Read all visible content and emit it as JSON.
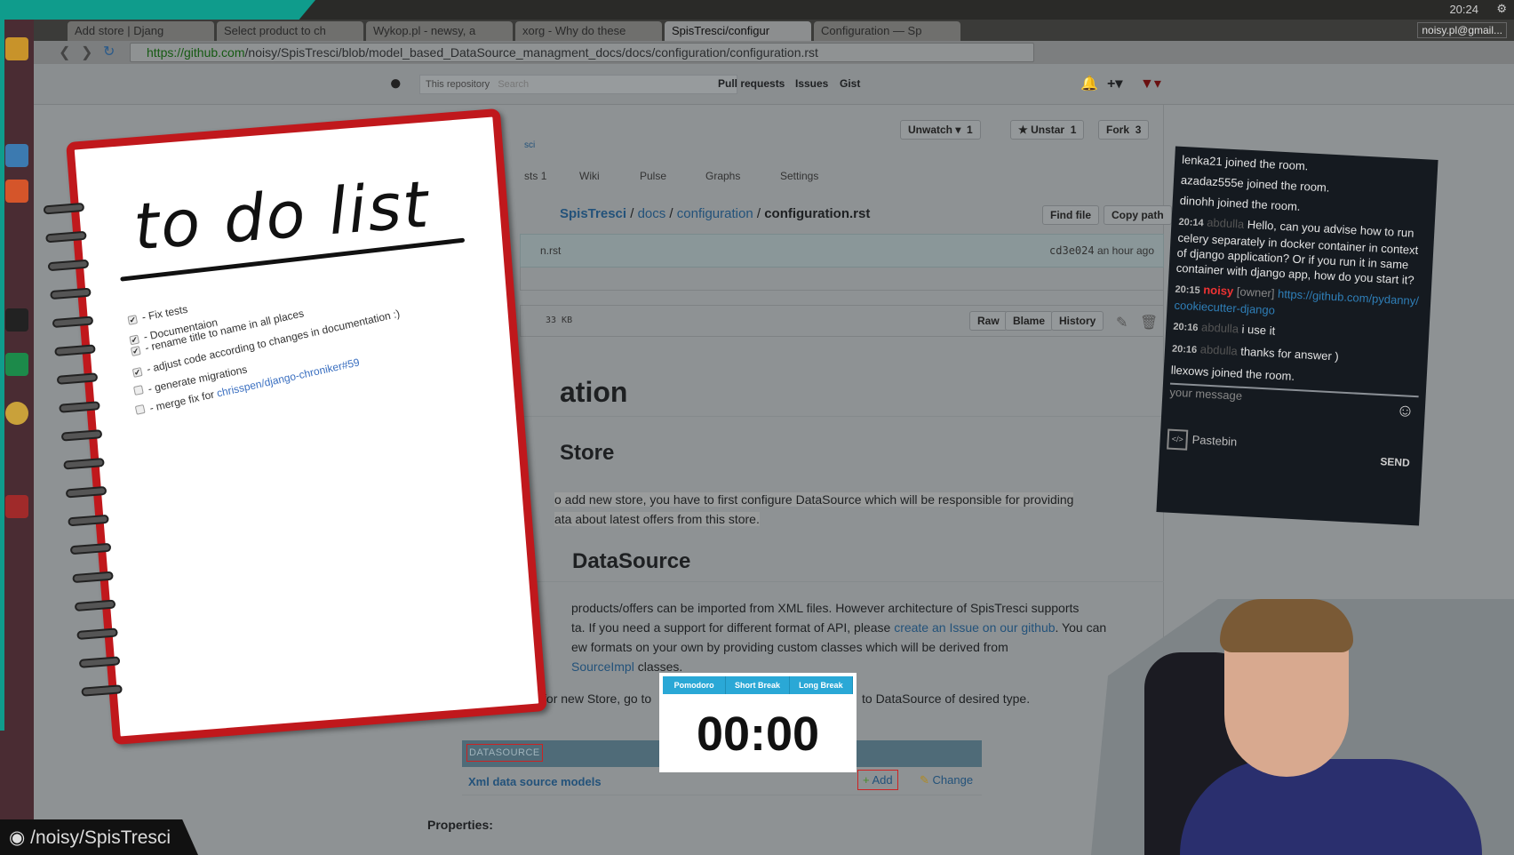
{
  "system": {
    "clock": "20:24",
    "user": "noisy.pl@gmail..."
  },
  "browser": {
    "tabs": [
      {
        "label": "Add store | Djang"
      },
      {
        "label": "Select product to ch"
      },
      {
        "label": "Wykop.pl - newsy, a"
      },
      {
        "label": "xorg - Why do these"
      },
      {
        "label": "SpisTresci/configur"
      },
      {
        "label": "Configuration — Sp"
      }
    ],
    "url_host": "https://github.com",
    "url_path": "/noisy/SpisTresci/blob/model_based_DataSource_managment_docs/docs/configuration/configuration.rst"
  },
  "github": {
    "search_scope": "This repository",
    "search_placeholder": "Search",
    "nav": [
      "Pull requests",
      "Issues",
      "Gist"
    ],
    "repo_fragment": "sci",
    "actions": [
      {
        "label": "Unwatch ▾",
        "count": "1"
      },
      {
        "label": "★ Unstar",
        "count": "1"
      },
      {
        "label": "Fork",
        "count": "3"
      }
    ],
    "tabs": [
      {
        "label": "sts",
        "count": "1"
      },
      {
        "label": "Wiki"
      },
      {
        "label": "Pulse"
      },
      {
        "label": "Graphs"
      },
      {
        "label": "Settings"
      }
    ],
    "breadcrumb": {
      "repo": "SpisTresci",
      "p1": "docs",
      "p2": "configuration",
      "file": "configuration.rst",
      "sep": " / "
    },
    "file_buttons": [
      "Find file",
      "Copy path"
    ],
    "commit": {
      "msg": "n.rst",
      "sha": "cd3e024",
      "time": "an hour ago"
    },
    "file_size": "33 KB",
    "file_actions": [
      "Raw",
      "Blame",
      "History"
    ],
    "content": {
      "h1": "ation",
      "h2a": "Store",
      "p1a": "o add new store, you have to first configure DataSource which will be responsible for providing",
      "p1b": "ata about latest offers from this store.",
      "h2b": "DataSource",
      "p2a": "products/offers can be imported from XML files. However architecture of SpisTresci supports",
      "p2b": "ta. If you need a support for different format of API, please ",
      "p2b_link": "create an Issue on our github",
      "p2b_end": ". You can",
      "p2c": "ew formats on your own by providing custom classes which will be derived from",
      "p2d_link": "SourceImpl",
      "p2d_end": " classes.",
      "p3a": "aSource for new Store, go to",
      "p3b": "to DataSource of desired type.",
      "table_header": "DATASOURCE",
      "table_row": "Xml data source models",
      "add": "Add",
      "change": "Change",
      "properties": "Properties:"
    }
  },
  "todo": {
    "title": "to do list",
    "items": [
      {
        "text": "- Fix tests",
        "checked": true
      },
      {
        "text": "- Documentaion",
        "checked": true
      },
      {
        "text": "- rename title to name in all places",
        "checked": true
      },
      {
        "text": "- adjust code according to changes in documentation :)",
        "checked": true
      },
      {
        "text": "- generate migrations",
        "checked": false
      },
      {
        "text": "- merge fix for ",
        "link": "chrisspen/django-chroniker#59",
        "checked": false
      }
    ]
  },
  "chat": {
    "messages": [
      {
        "text": "lenka21 joined the room."
      },
      {
        "text": "azadaz555e joined the room."
      },
      {
        "text": "dinohh joined the room."
      },
      {
        "time": "20:14",
        "user": "abdulla",
        "text": "Hello, can you advise how to run celery separately in docker container in context of django application? Or if you run it in same container with django app, how do you start it?"
      },
      {
        "time": "20:15",
        "user": "noisy",
        "role": "[owner]",
        "link": "https://github.com/pydanny/cookiecutter-django"
      },
      {
        "time": "20:16",
        "user": "abdulla",
        "text": "i use it"
      },
      {
        "time": "20:16",
        "user": "abdulla",
        "text": "thanks for answer )"
      },
      {
        "text": "llexows joined the room."
      }
    ],
    "placeholder": "your message",
    "pastebin": "Pastebin",
    "send": "SEND"
  },
  "pomodoro": {
    "tabs": [
      "Pomodoro",
      "Short Break",
      "Long Break"
    ],
    "time": "00:00",
    "accent": "#2aa8d6"
  },
  "overlay": {
    "repo_label": "/noisy/SpisTresci"
  }
}
